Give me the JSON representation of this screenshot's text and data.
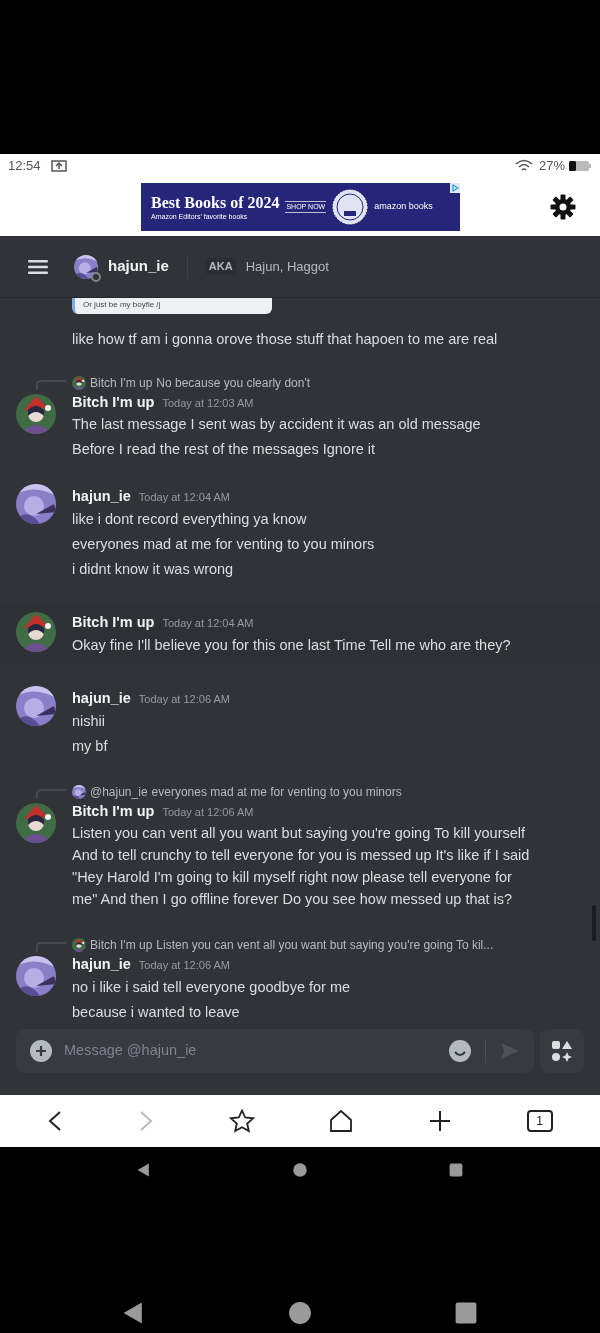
{
  "status_bar": {
    "time": "12:54",
    "battery": "27%"
  },
  "ad": {
    "headline": "Best Books of 2024",
    "cta": "SHOP NOW",
    "tagline": "Amazon Editors' favorite books",
    "brand": "amazon books"
  },
  "header": {
    "username": "hajun_ie",
    "aka_label": "AKA",
    "aka_names": "Hajun, Haggot"
  },
  "messages": [
    {
      "kind": "continuation",
      "embed": "Or just be my boyfie /j",
      "lines": [
        "like how tf am i gonna orove those stuff that hapoen to me are real"
      ]
    },
    {
      "kind": "message",
      "highlighted": false,
      "reply": {
        "author": "Bitch I'm up",
        "text": "No because you clearly don't"
      },
      "author": "Bitch I'm up",
      "time": "Today at 12:03 AM",
      "lines": [
        "The last message I sent was by accident it was an old message",
        "Before I read the rest of the messages Ignore it"
      ]
    },
    {
      "kind": "message",
      "highlighted": false,
      "author": "hajun_ie",
      "time": "Today at 12:04 AM",
      "lines": [
        "like i dont record everything ya know",
        "everyones mad at me for venting to you minors",
        "i didnt know it was wrong"
      ]
    },
    {
      "kind": "message",
      "highlighted": true,
      "author": "Bitch I'm up",
      "time": "Today at 12:04 AM",
      "lines": [
        "Okay fine I'll believe you for this one last Time Tell me who are they?"
      ]
    },
    {
      "kind": "message",
      "highlighted": false,
      "author": "hajun_ie",
      "time": "Today at 12:06 AM",
      "lines": [
        "nishii",
        "my bf"
      ]
    },
    {
      "kind": "message",
      "highlighted": false,
      "reply": {
        "author": "@hajun_ie",
        "text": "everyones mad at me for venting to you minors"
      },
      "author": "Bitch I'm up",
      "time": "Today at 12:06 AM",
      "lines": [
        "Listen you can vent all you want but saying you're going To kill yourself And to tell crunchy to tell everyone for you is messed up It's like if I said \"Hey Harold I'm going to kill myself right now please tell everyone for me\" And then I go offline forever Do you see how messed up that is?"
      ]
    },
    {
      "kind": "message",
      "highlighted": false,
      "reply": {
        "author": "Bitch I'm up",
        "text": "Listen you can vent all you want but saying you're going To kil..."
      },
      "author": "hajun_ie",
      "time": "Today at 12:06 AM",
      "lines": [
        "no i like i said tell everyone goodbye for me",
        "because i wanted to leave"
      ]
    }
  ],
  "composer": {
    "placeholder": "Message @hajun_ie"
  },
  "browser_nav": {
    "tab_count": "1"
  }
}
